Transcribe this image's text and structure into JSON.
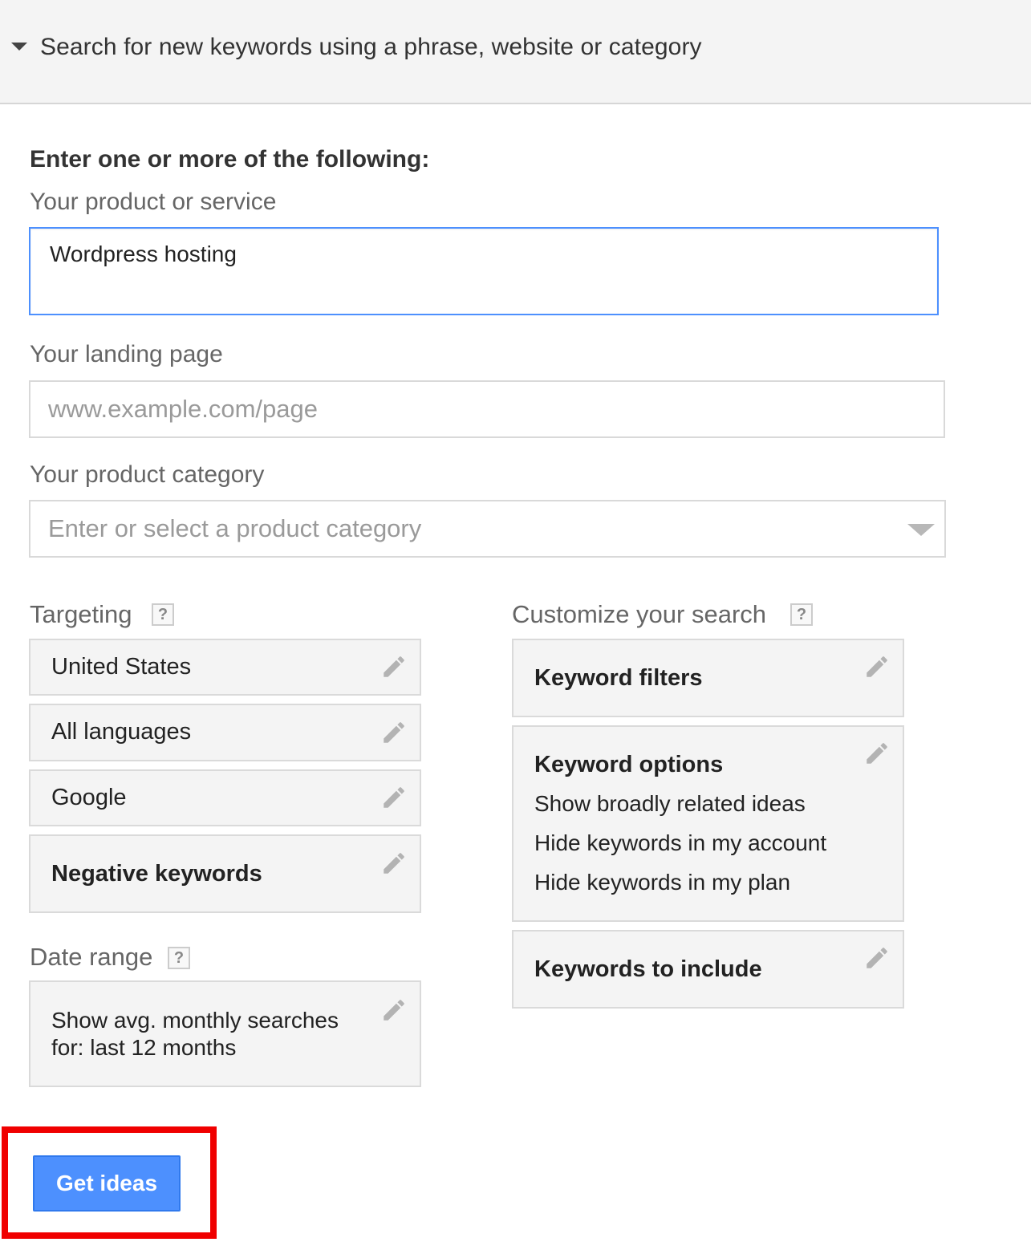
{
  "header": {
    "title": "Search for new keywords using a phrase, website or category"
  },
  "form": {
    "heading": "Enter one or more of the following:",
    "product_label": "Your product or service",
    "product_value": "Wordpress hosting",
    "landing_label": "Your landing page",
    "landing_placeholder": "www.example.com/page",
    "category_label": "Your product category",
    "category_placeholder": "Enter or select a product category"
  },
  "targeting": {
    "label": "Targeting",
    "help": "?",
    "items": [
      {
        "label": "United States"
      },
      {
        "label": "All languages"
      },
      {
        "label": "Google"
      },
      {
        "label": "Negative keywords"
      }
    ]
  },
  "date_range": {
    "label": "Date range",
    "help": "?",
    "line1": "Show avg. monthly searches",
    "line2": "for: last 12 months"
  },
  "customize": {
    "label": "Customize your search",
    "help": "?",
    "keyword_filters": "Keyword filters",
    "keyword_options": {
      "title": "Keyword options",
      "lines": [
        "Show broadly related ideas",
        "Hide keywords in my account",
        "Hide keywords in my plan"
      ]
    },
    "keywords_to_include": "Keywords to include"
  },
  "actions": {
    "get_ideas": "Get ideas"
  },
  "colors": {
    "accent": "#4d90fe",
    "highlight": "#f00000"
  },
  "icons": {
    "collapse": "caret-down-icon",
    "edit": "pencil-icon",
    "dropdown": "chevron-down-icon",
    "help": "help-icon"
  }
}
